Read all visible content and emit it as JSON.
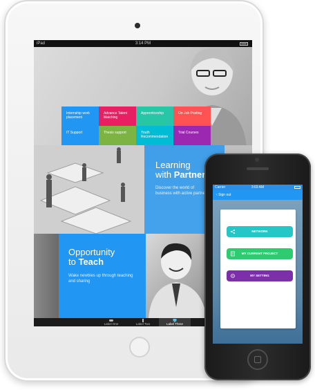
{
  "ipad": {
    "status": {
      "carrier": "iPad",
      "time": "3:14 PM"
    },
    "tiles": [
      {
        "label": "Internship work placement",
        "color": "#2196f3"
      },
      {
        "label": "Advance Talent Matching",
        "color": "#e91e63"
      },
      {
        "label": "Apprenticeship",
        "color": "#26c6a6"
      },
      {
        "label": "On Job Posting",
        "color": "#ff5252"
      },
      {
        "label": "IT Support",
        "color": "#2196f3"
      },
      {
        "label": "Thesis support",
        "color": "#7cb342"
      },
      {
        "label": "Youth Recommendation",
        "color": "#00bcd4"
      },
      {
        "label": "Trial Courses",
        "color": "#9c27b0"
      }
    ],
    "learning": {
      "title_line1": "Learning",
      "title_line2_prefix": "with ",
      "title_line2_bold": "Partners",
      "description": "Discover the world of business with active partners"
    },
    "teach": {
      "title_line1": "Opportunity",
      "title_line2_prefix": "to ",
      "title_line2_bold": "Teach",
      "description": "Wake newbies up through teaching and sharing"
    },
    "tabs": [
      {
        "label": "Label One",
        "icon": "gamepad-icon",
        "active": false
      },
      {
        "label": "Label Two",
        "icon": "phone-icon",
        "active": false
      },
      {
        "label": "Label Three",
        "icon": "monitor-icon",
        "active": true
      }
    ]
  },
  "iphone": {
    "status": {
      "carrier": "Carrier",
      "time": "3:03 AM"
    },
    "nav": {
      "back_label": "Sign out"
    },
    "buttons": [
      {
        "label": "NETWORK",
        "icon": "share-icon",
        "color": "#26c6c6"
      },
      {
        "label": "MY CURRENT PROJECT",
        "icon": "document-icon",
        "color": "#2ecc71"
      },
      {
        "label": "MY SETTING",
        "icon": "settings-icon",
        "color": "#7b2fa8"
      }
    ]
  }
}
